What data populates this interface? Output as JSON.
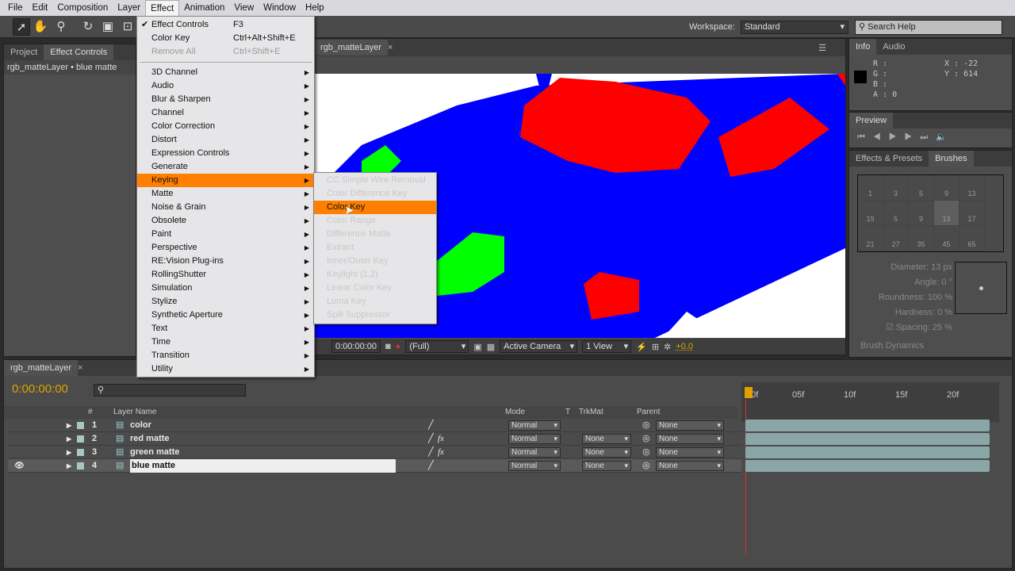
{
  "menubar": {
    "items": [
      "File",
      "Edit",
      "Composition",
      "Layer",
      "Effect",
      "Animation",
      "View",
      "Window",
      "Help"
    ],
    "open": "Effect"
  },
  "toolbar": {
    "workspace_label": "Workspace:",
    "workspace_value": "Standard",
    "search_placeholder": "Search Help"
  },
  "left_panel": {
    "tabs": [
      "Project",
      "Effect Controls"
    ],
    "breadcrumb": "rgb_matteLayer • blue matte"
  },
  "comp": {
    "tab": "rgb_matteLayer",
    "timecode": "0:00:00:00",
    "resolution": "(Full)",
    "camera": "Active Camera",
    "views": "1 View",
    "exposure": "+0.0"
  },
  "effect_menu": {
    "top": [
      {
        "label": "Effect Controls",
        "shortcut": "F3",
        "checked": true
      },
      {
        "label": "Color Key",
        "shortcut": "Ctrl+Alt+Shift+E"
      },
      {
        "label": "Remove All",
        "shortcut": "Ctrl+Shift+E",
        "disabled": true
      }
    ],
    "categories": [
      "3D Channel",
      "Audio",
      "Blur & Sharpen",
      "Channel",
      "Color Correction",
      "Distort",
      "Expression Controls",
      "Generate",
      "Keying",
      "Matte",
      "Noise & Grain",
      "Obsolete",
      "Paint",
      "Perspective",
      "RE:Vision Plug-ins",
      "RollingShutter",
      "Simulation",
      "Stylize",
      "Synthetic Aperture",
      "Text",
      "Time",
      "Transition",
      "Utility"
    ],
    "highlighted": "Keying"
  },
  "keying_submenu": {
    "items": [
      "CC Simple Wire Removal",
      "Color Difference Key",
      "Color Key",
      "Color Range",
      "Difference Matte",
      "Extract",
      "Inner/Outer Key",
      "Keylight (1.2)",
      "Linear Color Key",
      "Luma Key",
      "Spill Suppressor"
    ],
    "highlighted": "Color Key"
  },
  "info": {
    "tabs": [
      "Info",
      "Audio"
    ],
    "r": "R :",
    "g": "G :",
    "b": "B :",
    "a": "A : 0",
    "x": "X : -22",
    "y": "Y : 614",
    "swatch": "#000000"
  },
  "preview": {
    "tab": "Preview"
  },
  "brushes": {
    "tabs": [
      "Effects & Presets",
      "Brushes"
    ],
    "sizes": [
      "1",
      "3",
      "5",
      "9",
      "13",
      "19",
      "5",
      "9",
      "13",
      "17",
      "21",
      "27",
      "35",
      "45",
      "65"
    ],
    "selected_index": 8,
    "diameter_label": "Diameter:",
    "diameter": "13 px",
    "angle_label": "Angle:",
    "angle": "0 °",
    "roundness_label": "Roundness:",
    "roundness": "100 %",
    "hardness_label": "Hardness:",
    "hardness": "0 %",
    "spacing_label": "Spacing:",
    "spacing": "25 %",
    "dynamics": "Brush Dynamics"
  },
  "timeline": {
    "tab": "rgb_matteLayer",
    "timecode": "0:00:00:00",
    "ruler": [
      "00f",
      "05f",
      "10f",
      "15f",
      "20f"
    ],
    "headers": {
      "num": "#",
      "name": "Layer Name",
      "mode": "Mode",
      "t": "T",
      "trkmat": "TrkMat",
      "parent": "Parent"
    },
    "layers": [
      {
        "num": "1",
        "name": "color",
        "mode": "Normal",
        "trkmat": "",
        "parent": "None",
        "fx": false
      },
      {
        "num": "2",
        "name": "red matte",
        "mode": "Normal",
        "trkmat": "None",
        "parent": "None",
        "fx": true
      },
      {
        "num": "3",
        "name": "green matte",
        "mode": "Normal",
        "trkmat": "None",
        "parent": "None",
        "fx": true
      },
      {
        "num": "4",
        "name": "blue matte",
        "mode": "Normal",
        "trkmat": "None",
        "parent": "None",
        "fx": false,
        "selected": true
      }
    ]
  },
  "colors": {
    "highlight": "#ff7f00",
    "timecode": "#d9a400",
    "layer_bar": "#8aa6a6"
  }
}
